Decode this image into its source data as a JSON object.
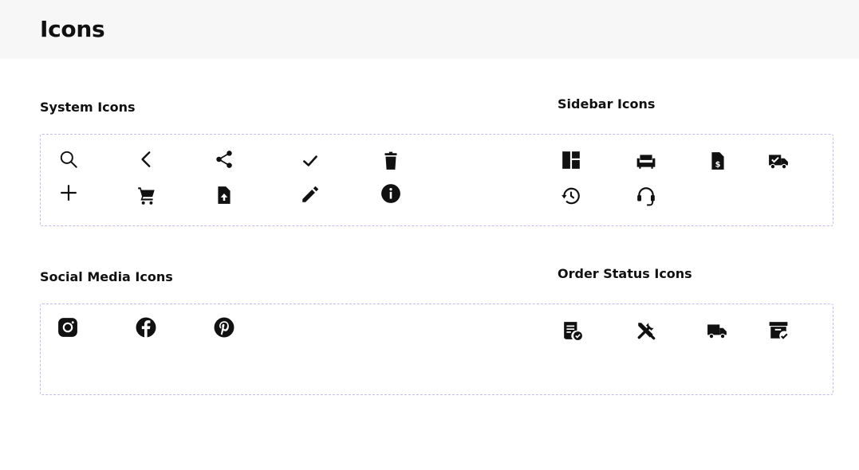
{
  "page": {
    "title": "Icons"
  },
  "sections": {
    "system": {
      "title": "System Icons"
    },
    "sidebar": {
      "title": "Sidebar Icons"
    },
    "social": {
      "title": "Social Media Icons"
    },
    "order_status": {
      "title": "Order Status Icons"
    }
  },
  "icons": {
    "system": [
      "search-icon",
      "chevron-left-icon",
      "share-icon",
      "check-icon",
      "trash-icon",
      "plus-icon",
      "cart-icon",
      "file-upload-icon",
      "pencil-icon",
      "info-icon"
    ],
    "sidebar": [
      "dashboard-icon",
      "sofa-icon",
      "invoice-icon",
      "delivery-check-icon",
      "history-icon",
      "headset-icon"
    ],
    "social": [
      "instagram-icon",
      "facebook-icon",
      "pinterest-icon"
    ],
    "order_status": [
      "order-received-icon",
      "tools-icon",
      "truck-icon",
      "archive-check-icon"
    ]
  },
  "colors": {
    "header_bg": "#f7f7f7",
    "panel_border": "#c7b9ef",
    "icon": "#111111"
  }
}
